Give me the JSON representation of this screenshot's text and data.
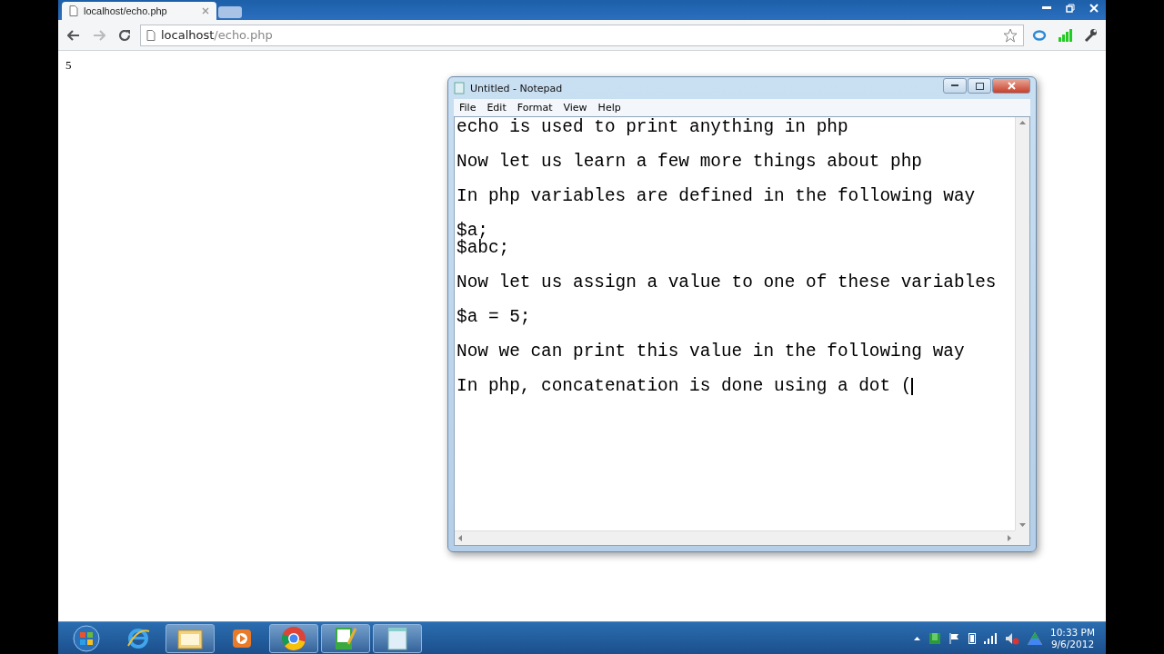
{
  "browser": {
    "tabs": [
      {
        "title": "localhost/echo.php",
        "selected": true
      }
    ],
    "address": {
      "host": "localhost",
      "path": "/echo.php"
    }
  },
  "page": {
    "text": "5"
  },
  "notepad": {
    "title": "Untitled - Notepad",
    "menu": [
      "File",
      "Edit",
      "Format",
      "View",
      "Help"
    ],
    "paragraphs": [
      [
        "echo is used to print anything in php"
      ],
      [
        "Now let us learn a few more things about php"
      ],
      [
        "In php variables are defined in the following way"
      ],
      [
        "$a;",
        "$abc;"
      ],
      [
        "Now let us assign a value to one of these variables"
      ],
      [
        "$a = 5;"
      ],
      [
        "Now we can print this value in the following way"
      ],
      [
        "In php, concatenation is done using a dot ("
      ]
    ]
  },
  "taskbar": {
    "items": [
      {
        "kind": "start",
        "running": false
      },
      {
        "kind": "ie",
        "running": false
      },
      {
        "kind": "folder",
        "running": true
      },
      {
        "kind": "media",
        "running": false
      },
      {
        "kind": "chrome",
        "running": true
      },
      {
        "kind": "editor",
        "running": true
      },
      {
        "kind": "notepad",
        "running": true
      }
    ],
    "time": "10:33 PM",
    "date": "9/6/2012"
  }
}
